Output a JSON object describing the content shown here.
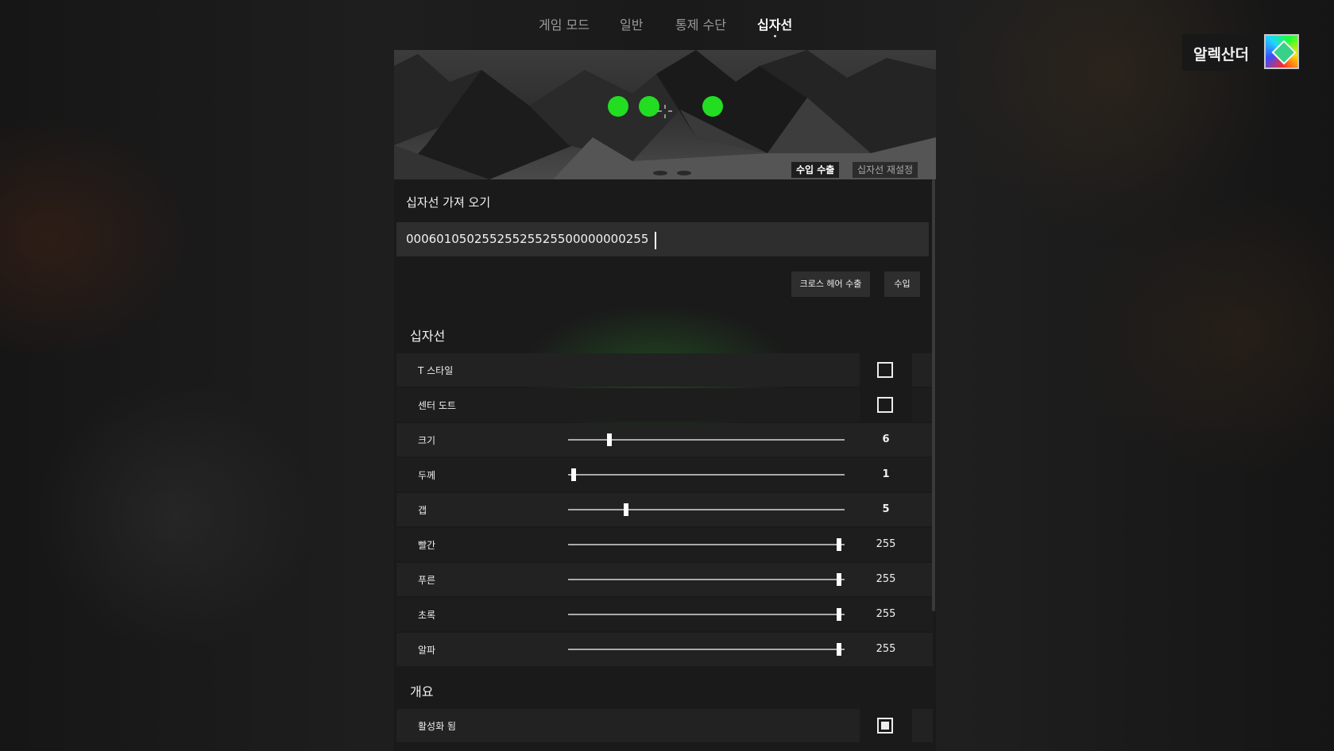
{
  "nav": {
    "tabs": [
      {
        "label": "게임 모드"
      },
      {
        "label": "일반"
      },
      {
        "label": "통제 수단"
      },
      {
        "label": "십자선"
      }
    ]
  },
  "user": {
    "name": "알렉산더"
  },
  "preview": {
    "export_label": "수입 수출",
    "reset_label": "십자선 재설정"
  },
  "import": {
    "title": "십자선 가져 오기",
    "code": "00060105025525525525500000000255",
    "export_button": "크로스 헤어 수출",
    "import_button": "수입"
  },
  "crosshair": {
    "title": "십자선",
    "toggles": [
      {
        "label": "T 스타일",
        "checked": false
      },
      {
        "label": "센터 도트",
        "checked": false
      }
    ],
    "sliders": [
      {
        "label": "크기",
        "value": "6",
        "fraction": 0.15
      },
      {
        "label": "두께",
        "value": "1",
        "fraction": 0.02
      },
      {
        "label": "갭",
        "value": "5",
        "fraction": 0.21
      },
      {
        "label": "빨간",
        "value": "255",
        "fraction": 0.98
      },
      {
        "label": "푸른",
        "value": "255",
        "fraction": 0.98
      },
      {
        "label": "초록",
        "value": "255",
        "fraction": 0.98
      },
      {
        "label": "알파",
        "value": "255",
        "fraction": 0.98
      }
    ]
  },
  "overview": {
    "title": "개요",
    "toggles": [
      {
        "label": "활성화 됨",
        "checked": true
      }
    ]
  },
  "colors": {
    "accent_green": "#22dd22",
    "panel_bg": "#1a1a1a"
  }
}
